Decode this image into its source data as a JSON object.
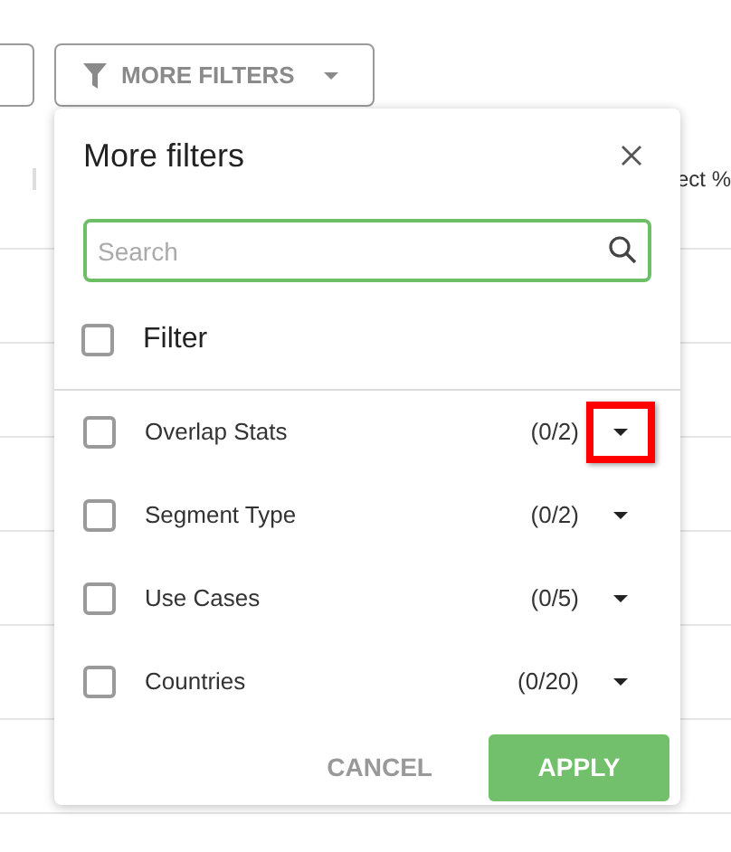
{
  "toolbar": {
    "more_filters_button": "MORE FILTERS"
  },
  "table": {
    "column_header": "ect %"
  },
  "popup": {
    "title": "More filters",
    "search": {
      "placeholder": "Search"
    },
    "select_all": {
      "label": "Filter",
      "checked": false
    },
    "filters": [
      {
        "label": "Overlap Stats",
        "count": "(0/2)",
        "checked": false,
        "highlighted": true
      },
      {
        "label": "Segment Type",
        "count": "(0/2)",
        "checked": false,
        "highlighted": false
      },
      {
        "label": "Use Cases",
        "count": "(0/5)",
        "checked": false,
        "highlighted": false
      },
      {
        "label": "Countries",
        "count": "(0/20)",
        "checked": false,
        "highlighted": false
      }
    ],
    "cancel": "CANCEL",
    "apply": "APPLY"
  }
}
